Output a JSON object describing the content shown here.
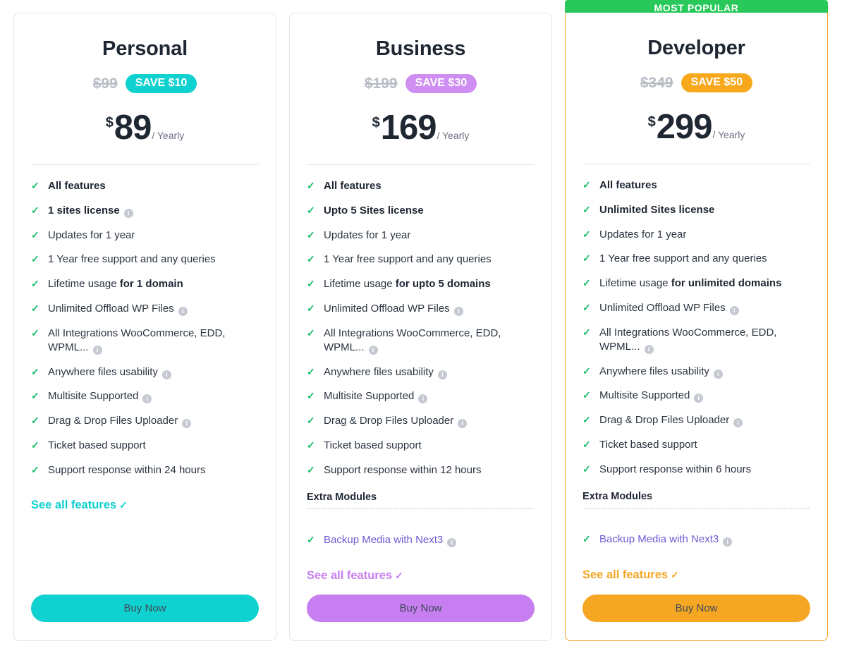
{
  "banner": {
    "label": "MOST POPULAR",
    "color": "#28c85a"
  },
  "icons": {
    "check": "✓",
    "info": "i",
    "see_all_tick": "✓"
  },
  "plans": [
    {
      "id": "personal",
      "name": "Personal",
      "old_price": "$99",
      "save_label": "SAVE $10",
      "currency": "$",
      "amount": "89",
      "period": "/ Yearly",
      "accent": "#0fd1cf",
      "badge_color": "#0fd1cf",
      "button_label": "Buy Now",
      "see_all_label": "See all features",
      "featured": false,
      "features": [
        {
          "text": "All features",
          "bold": true,
          "info": false
        },
        {
          "text": "1 sites license",
          "bold": true,
          "info": true
        },
        {
          "text": "Updates for 1 year",
          "bold": false,
          "info": false
        },
        {
          "text": "1 Year free support and any queries",
          "bold": false,
          "info": false
        },
        {
          "text": "Lifetime usage ",
          "strong": "for 1 domain",
          "bold": false,
          "info": false
        },
        {
          "text": "Unlimited Offload WP Files",
          "bold": false,
          "info": true
        },
        {
          "text": "All Integrations WooCommerce, EDD, WPML...",
          "bold": false,
          "info": true
        },
        {
          "text": "Anywhere files usability",
          "bold": false,
          "info": true
        },
        {
          "text": "Multisite Supported",
          "bold": false,
          "info": true
        },
        {
          "text": "Drag & Drop Files Uploader",
          "bold": false,
          "info": true
        },
        {
          "text": "Ticket based support",
          "bold": false,
          "info": false
        },
        {
          "text": "Support response within 24 hours",
          "bold": false,
          "info": false
        }
      ],
      "extra_modules_label": null,
      "extra_modules": []
    },
    {
      "id": "business",
      "name": "Business",
      "old_price": "$199",
      "save_label": "SAVE $30",
      "currency": "$",
      "amount": "169",
      "period": "/ Yearly",
      "accent": "#c77ef0",
      "badge_color": "#ce8ef2",
      "button_label": "Buy Now",
      "see_all_label": "See all features",
      "featured": false,
      "features": [
        {
          "text": "All features",
          "bold": true,
          "info": false
        },
        {
          "text": "Upto 5 Sites license",
          "bold": true,
          "info": false
        },
        {
          "text": "Updates for 1 year",
          "bold": false,
          "info": false
        },
        {
          "text": "1 Year free support and any queries",
          "bold": false,
          "info": false
        },
        {
          "text": "Lifetime usage ",
          "strong": "for upto 5 domains",
          "bold": false,
          "info": false
        },
        {
          "text": "Unlimited Offload WP Files",
          "bold": false,
          "info": true
        },
        {
          "text": "All Integrations WooCommerce, EDD, WPML...",
          "bold": false,
          "info": true
        },
        {
          "text": "Anywhere files usability",
          "bold": false,
          "info": true
        },
        {
          "text": "Multisite Supported",
          "bold": false,
          "info": true
        },
        {
          "text": "Drag & Drop Files Uploader",
          "bold": false,
          "info": true
        },
        {
          "text": "Ticket based support",
          "bold": false,
          "info": false
        },
        {
          "text": "Support response within 12 hours",
          "bold": false,
          "info": false
        }
      ],
      "extra_modules_label": "Extra Modules",
      "extra_modules": [
        {
          "text": "Backup Media with Next3",
          "info": true
        }
      ]
    },
    {
      "id": "developer",
      "name": "Developer",
      "old_price": "$349",
      "save_label": "SAVE $50",
      "currency": "$",
      "amount": "299",
      "period": "/ Yearly",
      "accent": "#f5a623",
      "badge_color": "#f7a81b",
      "button_label": "Buy Now",
      "see_all_label": "See all features",
      "featured": true,
      "features": [
        {
          "text": "All features",
          "bold": true,
          "info": false
        },
        {
          "text": "Unlimited Sites license",
          "bold": true,
          "info": false
        },
        {
          "text": "Updates for 1 year",
          "bold": false,
          "info": false
        },
        {
          "text": "1 Year free support and any queries",
          "bold": false,
          "info": false
        },
        {
          "text": "Lifetime usage ",
          "strong": "for unlimited domains",
          "bold": false,
          "info": false
        },
        {
          "text": "Unlimited Offload WP Files",
          "bold": false,
          "info": true
        },
        {
          "text": "All Integrations WooCommerce, EDD, WPML...",
          "bold": false,
          "info": true
        },
        {
          "text": "Anywhere files usability",
          "bold": false,
          "info": true
        },
        {
          "text": "Multisite Supported",
          "bold": false,
          "info": true
        },
        {
          "text": "Drag & Drop Files Uploader",
          "bold": false,
          "info": true
        },
        {
          "text": "Ticket based support",
          "bold": false,
          "info": false
        },
        {
          "text": "Support response within 6 hours",
          "bold": false,
          "info": false
        }
      ],
      "extra_modules_label": "Extra Modules",
      "extra_modules": [
        {
          "text": "Backup Media with Next3",
          "info": true
        }
      ]
    }
  ]
}
